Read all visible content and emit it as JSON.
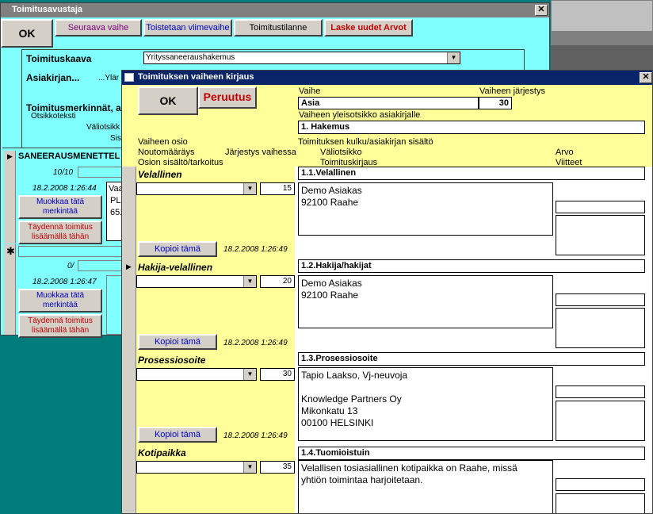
{
  "back_window": {
    "title": "Toimitusavustaja",
    "buttons": {
      "ok": "OK",
      "next": "Seuraava vaihe",
      "repeat": "Toistetaan viimevaihe",
      "status": "Toimitustilanne",
      "recalc": "Laske uudet Arvot"
    },
    "toimituskaava_label": "Toimituskaava",
    "toimituskaava_value": "Yrityssaneeraushakemus",
    "asiakirjan_label": "Asiakirjan...",
    "asiakirjan_sub": "...Ylär",
    "toimitusmerkinnat_label": "Toimitusmerkinnät, as",
    "otsikkoteksti": "Otsikkoteksti",
    "valiotsikko": "Väliotsikk",
    "sis": "Sis"
  },
  "sub_form": {
    "header": "SANEERAUSMENETTEL",
    "rec1": {
      "counter": "10/10",
      "date": "18.2.2008 1:26:44",
      "text_l1": "Vaa",
      "text_l2": "PL",
      "text_l3": "651",
      "edit_btn": "Muokkaa tätä merkintää",
      "add_btn": "Täydennä toimitus lisäämällä tähän"
    },
    "rec2": {
      "counter": "0/",
      "date": "18.2.2008 1:26:47",
      "edit_btn": "Muokkaa tätä merkintää",
      "add_btn": "Täydennä toimitus lisäämällä tähän"
    }
  },
  "main": {
    "title": "Toimituksen vaiheen kirjaus",
    "ok": "OK",
    "cancel": "Peruutus",
    "vaihe_label": "Vaihe",
    "vaihe_value": "Asia",
    "jarjestys_label": "Vaiheen järjestys",
    "jarjestys_value": "30",
    "yleisotsikko_label": "Vaiheen yleisotsikko asiakirjalle",
    "yleisotsikko_value": "1. Hakemus",
    "col_headers": {
      "vaiheen_osio": "Vaiheen osio",
      "noutomaarays": "Noutomääräys",
      "jarjestys_vaiheessa": "Järjestys vaihessa",
      "osion_sisalto": "Osion sisältö/tarkoitus",
      "kulku": "Toimituksen kulku/asiakirjan sisältö",
      "valiotsikko": "Väliotsikko",
      "toimituskirjaus": "Toimituskirjaus",
      "arvo": "Arvo",
      "viitteet": "Viitteet"
    },
    "rows": [
      {
        "osio": "Velallinen",
        "order": "15",
        "valiotsikko": "1.1.Velallinen",
        "content": "Demo Asiakas\n92100 Raahe",
        "copy_btn": "Kopioi tämä",
        "date": "18.2.2008 1:26:49"
      },
      {
        "osio": "Hakija-velallinen",
        "order": "20",
        "valiotsikko": "1.2.Hakija/hakijat",
        "content": "Demo Asiakas\n92100 Raahe",
        "copy_btn": "Kopioi tämä",
        "date": "18.2.2008 1:26:49"
      },
      {
        "osio": "Prosessiosoite",
        "order": "30",
        "valiotsikko": "1.3.Prosessiosoite",
        "content": "Tapio Laakso, Vj-neuvoja\n\nKnowledge Partners Oy\nMikonkatu 13\n00100 HELSINKI",
        "copy_btn": "Kopioi tämä",
        "date": "18.2.2008 1:26:49"
      },
      {
        "osio": "Kotipaikka",
        "order": "35",
        "valiotsikko": "1.4.Tuomioistuin",
        "content": "Velallisen tosiasiallinen kotipaikka on Raahe, missä\nyhtiön toimintaa harjoitetaan."
      }
    ]
  }
}
